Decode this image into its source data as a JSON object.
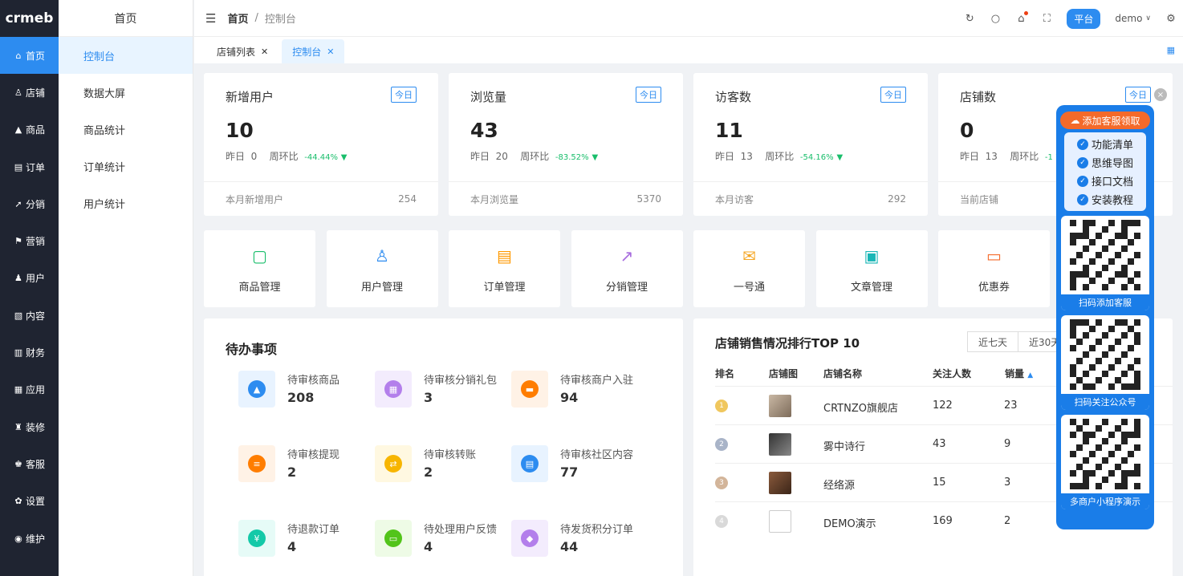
{
  "logo": "crmeb",
  "sidebar": [
    {
      "label": "首页",
      "icon": "home-icon"
    },
    {
      "label": "店铺",
      "icon": "store-icon"
    },
    {
      "label": "商品",
      "icon": "goods-icon"
    },
    {
      "label": "订单",
      "icon": "order-icon"
    },
    {
      "label": "分销",
      "icon": "distribution-icon"
    },
    {
      "label": "营销",
      "icon": "marketing-icon"
    },
    {
      "label": "用户",
      "icon": "user-icon"
    },
    {
      "label": "内容",
      "icon": "content-icon"
    },
    {
      "label": "财务",
      "icon": "finance-icon"
    },
    {
      "label": "应用",
      "icon": "apps-icon"
    },
    {
      "label": "装修",
      "icon": "decorate-icon"
    },
    {
      "label": "客服",
      "icon": "service-icon"
    },
    {
      "label": "设置",
      "icon": "settings-icon"
    },
    {
      "label": "维护",
      "icon": "maintain-icon"
    }
  ],
  "subnav": {
    "title": "首页",
    "items": [
      "控制台",
      "数据大屏",
      "商品统计",
      "订单统计",
      "用户统计"
    ]
  },
  "header": {
    "crumb_home": "首页",
    "crumb_sep": "/",
    "crumb_current": "控制台",
    "platform": "平台",
    "user": "demo"
  },
  "tabs": [
    {
      "label": "店铺列表"
    },
    {
      "label": "控制台"
    }
  ],
  "stats": [
    {
      "title": "新增用户",
      "tag": "今日",
      "value": "10",
      "yesterday_label": "昨日",
      "yesterday": "0",
      "ratio_label": "周环比",
      "ratio": "-44.44%",
      "foot_label": "本月新增用户",
      "foot_value": "254"
    },
    {
      "title": "浏览量",
      "tag": "今日",
      "value": "43",
      "yesterday_label": "昨日",
      "yesterday": "20",
      "ratio_label": "周环比",
      "ratio": "-83.52%",
      "foot_label": "本月浏览量",
      "foot_value": "5370"
    },
    {
      "title": "访客数",
      "tag": "今日",
      "value": "11",
      "yesterday_label": "昨日",
      "yesterday": "13",
      "ratio_label": "周环比",
      "ratio": "-54.16%",
      "foot_label": "本月访客",
      "foot_value": "292"
    },
    {
      "title": "店铺数",
      "tag": "今日",
      "value": "0",
      "yesterday_label": "昨日",
      "yesterday": "13",
      "ratio_label": "周环比",
      "ratio": "-1",
      "foot_label": "当前店铺",
      "foot_value": ""
    }
  ],
  "quick": [
    {
      "label": "商品管理",
      "color": "#19be6b"
    },
    {
      "label": "用户管理",
      "color": "#2d8cf0"
    },
    {
      "label": "订单管理",
      "color": "#ff9900"
    },
    {
      "label": "分销管理",
      "color": "#a66bde"
    },
    {
      "label": "一号通",
      "color": "#f5a623"
    },
    {
      "label": "文章管理",
      "color": "#19b6b6"
    },
    {
      "label": "优惠券",
      "color": "#f56c2c"
    }
  ],
  "todo": {
    "title": "待办事项",
    "items": [
      {
        "label": "待审核商品",
        "value": "208",
        "bg": "#e8f3ff",
        "fg": "#2d8cf0",
        "glyph": "▲"
      },
      {
        "label": "待审核分销礼包",
        "value": "3",
        "bg": "#f3ecfd",
        "fg": "#b37feb",
        "glyph": "▦"
      },
      {
        "label": "待审核商户入驻",
        "value": "94",
        "bg": "#fff2e6",
        "fg": "#ff7d00",
        "glyph": "▬"
      },
      {
        "label": "待审核提现",
        "value": "2",
        "bg": "#fff2e6",
        "fg": "#ff7d00",
        "glyph": "≡"
      },
      {
        "label": "待审核转账",
        "value": "2",
        "bg": "#fff8e1",
        "fg": "#f7b500",
        "glyph": "⇄"
      },
      {
        "label": "待审核社区内容",
        "value": "77",
        "bg": "#e8f3ff",
        "fg": "#2d8cf0",
        "glyph": "▤"
      },
      {
        "label": "待退款订单",
        "value": "4",
        "bg": "#e6fbf7",
        "fg": "#14c9a8",
        "glyph": "¥"
      },
      {
        "label": "待处理用户反馈",
        "value": "4",
        "bg": "#eefbe6",
        "fg": "#52c41a",
        "glyph": "▭"
      },
      {
        "label": "待发货积分订单",
        "value": "44",
        "bg": "#f3ecfd",
        "fg": "#b37feb",
        "glyph": "◆"
      }
    ]
  },
  "ranking": {
    "title": "店铺销售情况排行TOP 10",
    "ranges": [
      "近七天",
      "近30天"
    ],
    "columns": [
      "排名",
      "店铺图",
      "店铺名称",
      "关注人数",
      "销量"
    ],
    "rows": [
      {
        "rank": "1",
        "name": "CRTNZO旗舰店",
        "followers": "122",
        "sales": "23",
        "dot": "#f0c75e"
      },
      {
        "rank": "2",
        "name": "雾中诗行",
        "followers": "43",
        "sales": "9",
        "dot": "#a9b4c8"
      },
      {
        "rank": "3",
        "name": "经络源",
        "followers": "15",
        "sales": "3",
        "dot": "#d3b59a"
      },
      {
        "rank": "4",
        "name": "DEMO演示",
        "followers": "169",
        "sales": "2",
        "dot": "#d9d9d9"
      }
    ]
  },
  "float": {
    "head": "添加客服领取",
    "items": [
      "功能清单",
      "思维导图",
      "接口文档",
      "安装教程"
    ],
    "qr": [
      "扫码添加客服",
      "扫码关注公众号",
      "多商户小程序演示"
    ],
    "close": "×"
  }
}
